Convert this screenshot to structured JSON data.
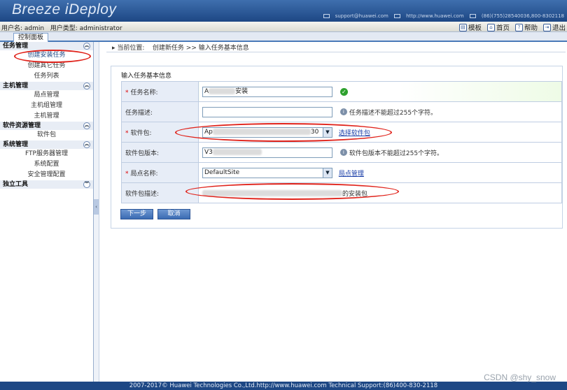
{
  "header": {
    "logo": "Breeze iDeploy",
    "support_email": "support@huawei.com",
    "support_url": "http://www.huawei.com",
    "phone": "(86)(755)28540036,800-8302118"
  },
  "user_bar": {
    "user_label": "用户名:",
    "user_name": "admin",
    "type_label": "用户类型:",
    "user_type": "administrator",
    "links": [
      {
        "label": "模板",
        "icon": "template-icon"
      },
      {
        "label": "首页",
        "icon": "home-icon"
      },
      {
        "label": "帮助",
        "icon": "help-icon"
      },
      {
        "label": "退出",
        "icon": "logout-icon"
      }
    ]
  },
  "tabs": {
    "control_panel": "控制面板"
  },
  "sidebar": {
    "groups": [
      {
        "title": "任务管理",
        "items": [
          "创建安装任务",
          "创建其它任务",
          "任务列表"
        ]
      },
      {
        "title": "主机管理",
        "items": [
          "局点管理",
          "主机组管理",
          "主机管理"
        ]
      },
      {
        "title": "软件资源管理",
        "items": [
          "软件包"
        ]
      },
      {
        "title": "系统管理",
        "items": [
          "FTP服务器管理",
          "系统配置",
          "安全管理配置"
        ]
      },
      {
        "title": "独立工具",
        "items": []
      }
    ]
  },
  "breadcrumb": {
    "prefix": "当前位置:",
    "path": "创建新任务 >> 输入任务基本信息"
  },
  "form": {
    "section_title": "输入任务基本信息",
    "rows": [
      {
        "label": "任务名称:",
        "required": true,
        "value_prefix": "A",
        "value_suffix": "安装"
      },
      {
        "label": "任务描述:",
        "required": false,
        "value": "",
        "hint": "任务描述不能超过255个字符。"
      },
      {
        "label": "软件包:",
        "required": true,
        "value_prefix": "Ap",
        "value_suffix": "30",
        "link": "选择软件包"
      },
      {
        "label": "软件包版本:",
        "required": false,
        "value_prefix": "V3",
        "hint": "软件包版本不能超过255个字符。"
      },
      {
        "label": "局点名称:",
        "required": true,
        "value": "DefaultSite",
        "link": "局点管理"
      },
      {
        "label": "软件包描述:",
        "required": false,
        "value_suffix": "的安装包"
      }
    ],
    "next_button": "下一步",
    "cancel_button": "取消"
  },
  "footer": {
    "text": "2007-2017© Huawei Technologies Co.,Ltd.http://www.huawei.com   Technical Support:(86)400-830-2118"
  },
  "watermark": "CSDN @shy_snow",
  "colors": {
    "annotation": "#e0221a",
    "header": "#1d4784"
  }
}
